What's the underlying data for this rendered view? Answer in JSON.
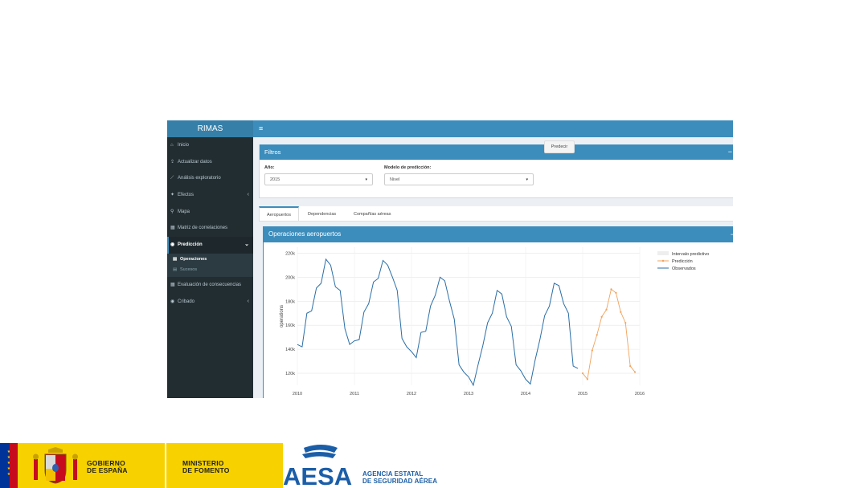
{
  "app": {
    "logo": "RIMAS",
    "hamburger_icon": "≡"
  },
  "sidebar": {
    "items": [
      {
        "label": "Inicio",
        "icon": "home-icon",
        "glyph": "⌂"
      },
      {
        "label": "Actualizar datos",
        "icon": "upload-icon",
        "glyph": "⇪"
      },
      {
        "label": "Análisis exploratorio",
        "icon": "line-chart-icon",
        "glyph": "⟋"
      },
      {
        "label": "Efectos",
        "icon": "users-icon",
        "glyph": "✦",
        "chevron": "‹"
      },
      {
        "label": "Mapa",
        "icon": "map-marker-icon",
        "glyph": "⚲"
      },
      {
        "label": "Matriz de correlaciones",
        "icon": "table-icon",
        "glyph": "▦"
      },
      {
        "label": "Predicción",
        "icon": "binoculars-icon",
        "glyph": "◉",
        "chevron": "⌄"
      },
      {
        "label": "Evaluación de consecuencias",
        "icon": "table-icon",
        "glyph": "▦"
      },
      {
        "label": "Cribado",
        "icon": "binoculars-icon",
        "glyph": "◉",
        "chevron": "‹"
      }
    ],
    "submenu": [
      {
        "label": "Operaciones",
        "icon": "calendar-icon",
        "glyph": "▤"
      },
      {
        "label": "Sucesos",
        "icon": "calendar-icon",
        "glyph": "▤"
      }
    ]
  },
  "filters": {
    "title": "Filtros",
    "collapse": "−",
    "year_label": "Año:",
    "year_value": "2015",
    "model_label": "Modelo de predicción:",
    "model_value": "Nivel",
    "caret": "▾",
    "predict_button": "Predecir"
  },
  "tabs": [
    "Aeropuertos",
    "Dependencias",
    "Compañías aéreas"
  ],
  "chart_box": {
    "title": "Operaciones aeropuertos",
    "collapse": "−"
  },
  "chart_data": {
    "type": "line",
    "title": "",
    "xlabel": "",
    "ylabel": "operations",
    "xlim": [
      2010,
      2016
    ],
    "ylim": [
      110000,
      225000
    ],
    "x_ticks": [
      2010,
      2011,
      2012,
      2013,
      2014,
      2015,
      2016
    ],
    "x_tick_labels": [
      "2010",
      "2011",
      "2012",
      "2013",
      "2014",
      "2015",
      "2016"
    ],
    "y_ticks": [
      120000,
      140000,
      160000,
      180000,
      200000,
      220000
    ],
    "y_tick_labels": [
      "120k",
      "140k",
      "160k",
      "180k",
      "200k",
      "220k"
    ],
    "grid": true,
    "legend_position": "top-right",
    "legend": [
      {
        "label": "Intervalo predictivo",
        "color": "#eeeeee",
        "kind": "band"
      },
      {
        "label": "Predicción",
        "color": "#f0a35e",
        "kind": "line-markers"
      },
      {
        "label": "Observados",
        "color": "#2a6ea6",
        "kind": "line"
      }
    ],
    "series": [
      {
        "name": "Observados",
        "color": "#2a6ea6",
        "x_start": 2010,
        "step_months": 1,
        "values": [
          144000,
          142000,
          170000,
          172000,
          191000,
          195000,
          215000,
          210000,
          192000,
          189000,
          157000,
          144000,
          147000,
          148000,
          171000,
          178000,
          196000,
          199000,
          214000,
          210000,
          200000,
          189000,
          149000,
          142000,
          138000,
          133000,
          154000,
          155000,
          176000,
          185000,
          200000,
          197000,
          180000,
          165000,
          127000,
          121000,
          117000,
          110000,
          127000,
          143000,
          162000,
          170000,
          189000,
          186000,
          167000,
          159000,
          127000,
          122000,
          115000,
          111000,
          131000,
          148000,
          168000,
          176000,
          195000,
          193000,
          178000,
          170000,
          126000,
          124000
        ]
      },
      {
        "name": "Predicción",
        "color": "#f0a35e",
        "x_start": 2015,
        "step_months": 1,
        "values": [
          120000,
          115000,
          139000,
          152000,
          167000,
          173000,
          190000,
          187000,
          171000,
          162000,
          126000,
          121000
        ]
      }
    ]
  },
  "footer": {
    "gov_line1": "GOBIERNO",
    "gov_line2": "DE ESPAÑA",
    "ministry_line1": "MINISTERIO",
    "ministry_line2": "DE FOMENTO",
    "aesa_logo_text": "AESA",
    "aesa_line1": "AGENCIA ESTATAL",
    "aesa_line2": "DE SEGURIDAD AÉREA",
    "gov_color": "#f7d200",
    "aesa_color": "#1b5ea8"
  }
}
